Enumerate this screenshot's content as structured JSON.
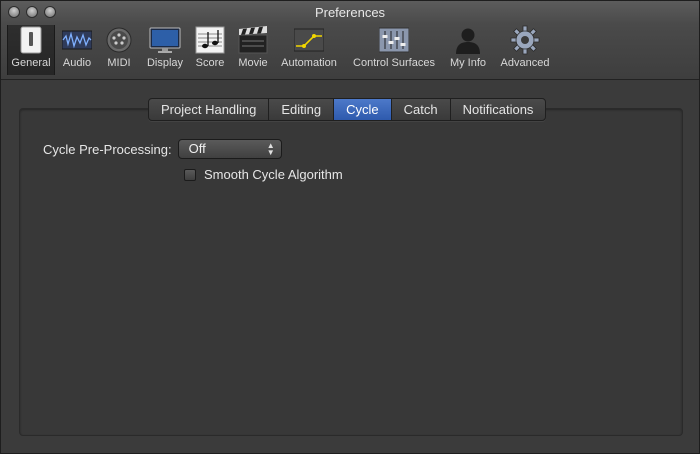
{
  "window": {
    "title": "Preferences"
  },
  "toolbar": {
    "items": [
      {
        "label": "General",
        "icon": "general-switch-icon"
      },
      {
        "label": "Audio",
        "icon": "audio-waveform-icon"
      },
      {
        "label": "MIDI",
        "icon": "midi-connector-icon"
      },
      {
        "label": "Display",
        "icon": "monitor-icon"
      },
      {
        "label": "Score",
        "icon": "music-notes-icon"
      },
      {
        "label": "Movie",
        "icon": "clapperboard-icon"
      },
      {
        "label": "Automation",
        "icon": "automation-curve-icon"
      },
      {
        "label": "Control Surfaces",
        "icon": "faders-icon"
      },
      {
        "label": "My Info",
        "icon": "person-icon"
      },
      {
        "label": "Advanced",
        "icon": "gear-icon"
      }
    ],
    "selected": "General"
  },
  "tabs": [
    "Project Handling",
    "Editing",
    "Cycle",
    "Catch",
    "Notifications"
  ],
  "active_tab": "Cycle",
  "cycle": {
    "preprocessing_label": "Cycle Pre-Processing:",
    "preprocessing_value": "Off",
    "smooth_label": "Smooth Cycle Algorithm",
    "smooth_checked": false
  },
  "colors": {
    "accent": "#3c6cc4",
    "background": "#3b3b3b"
  }
}
